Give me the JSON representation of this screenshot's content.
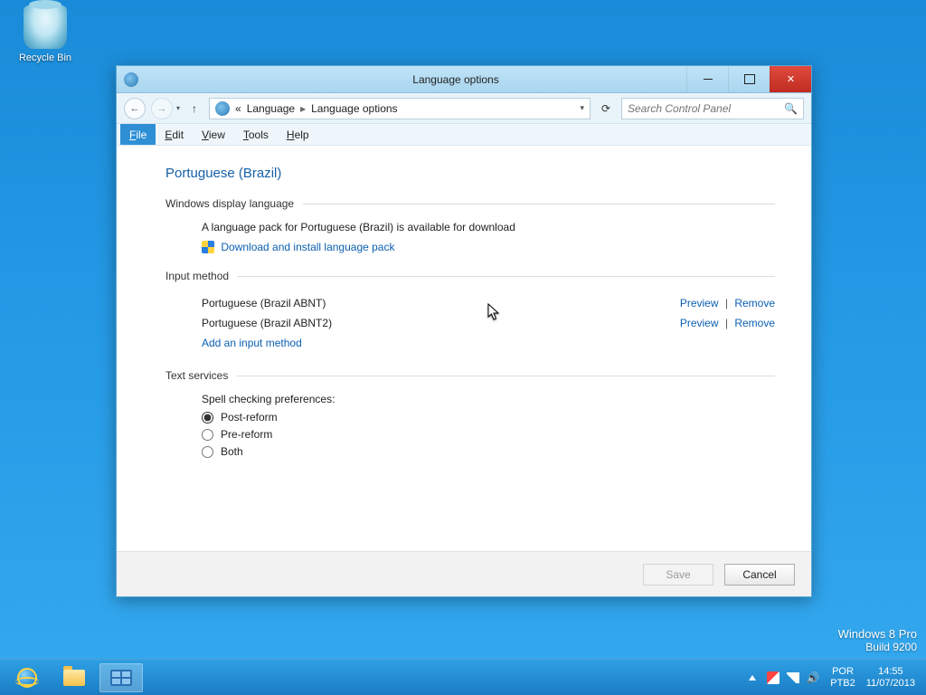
{
  "desktop": {
    "recycle_bin": "Recycle Bin"
  },
  "watermark": {
    "line1": "Windows 8 Pro",
    "line2": "Build 9200"
  },
  "taskbar": {
    "lang_top": "POR",
    "lang_bottom": "PTB2",
    "time": "14:55",
    "date": "11/07/2013"
  },
  "window": {
    "title": "Language options",
    "breadcrumb": {
      "prefix": "«",
      "a": "Language",
      "b": "Language options"
    },
    "search_placeholder": "Search Control Panel",
    "menubar": {
      "file": "File",
      "edit": "Edit",
      "view": "View",
      "tools": "Tools",
      "help": "Help"
    }
  },
  "page": {
    "heading": "Portuguese (Brazil)",
    "sections": {
      "display": {
        "label": "Windows display language",
        "msg": "A language pack for Portuguese (Brazil) is available for download",
        "download_link": "Download and install language pack"
      },
      "input": {
        "label": "Input method",
        "methods": [
          {
            "name": "Portuguese (Brazil ABNT)"
          },
          {
            "name": "Portuguese (Brazil ABNT2)"
          }
        ],
        "preview": "Preview",
        "remove": "Remove",
        "add_link": "Add an input method"
      },
      "text_services": {
        "label": "Text services",
        "pref_label": "Spell checking preferences:",
        "options": {
          "post": "Post-reform",
          "pre": "Pre-reform",
          "both": "Both"
        }
      }
    },
    "buttons": {
      "save": "Save",
      "cancel": "Cancel"
    }
  }
}
